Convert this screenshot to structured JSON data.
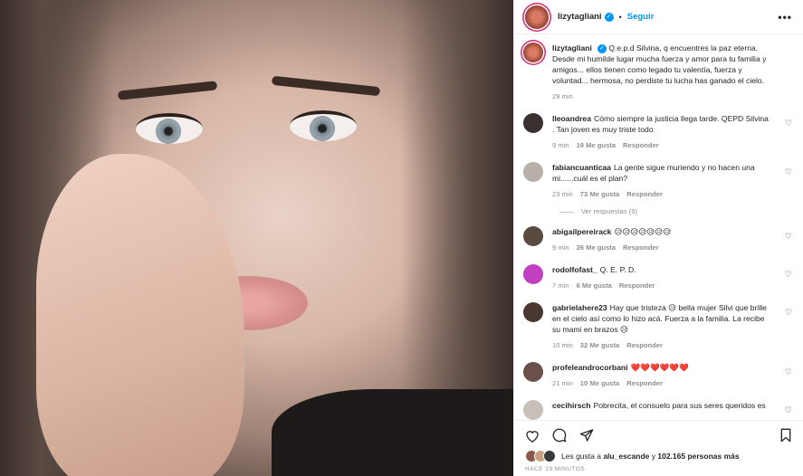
{
  "post_header": {
    "username": "lizytagliani",
    "separator": "•",
    "follow_label": "Seguir",
    "more_icon": "more-horizontal-icon",
    "verified_icon": "verified-badge-icon"
  },
  "caption": {
    "username": "lizytagliani",
    "text": "Q.e.p.d Silvina, q encuentres la paz eterna. Desde mi humilde lugar mucha fuerza y amor para tu familia y amigos... ellos tienen como legado tu valentía, fuerza y voluntad... hermosa, no perdiste tu lucha has ganado el cielo.",
    "time": "29 min"
  },
  "comments": [
    {
      "user": "lleoandrea",
      "text": "Cómo siempre la justicia llega tarde. QEPD Silvina . Tan joven es muy triste todo",
      "time": "9 min",
      "likes": "19 Me gusta",
      "reply": "Responder",
      "avatar_color": "#3a3030"
    },
    {
      "user": "fabiancuanticaa",
      "text": "La gente sigue muriendo y no hacen una mi......cuál es el plan?",
      "time": "23 min",
      "likes": "73 Me gusta",
      "reply": "Responder",
      "avatar_color": "#b8b0a8"
    },
    {
      "user": "abigailpereirack",
      "text": "😥😥😥😥😥😥😥",
      "time": "9 min",
      "likes": "26 Me gusta",
      "reply": "Responder",
      "avatar_color": "#5a4a40"
    },
    {
      "user": "rodolfofast_",
      "text": "Q. E. P. D.",
      "time": "7 min",
      "likes": "6 Me gusta",
      "reply": "Responder",
      "avatar_color": "#c040c0"
    },
    {
      "user": "gabrielahere23",
      "text": "Hay que tristeza 😥 bella mujer Silvi que brille en el cielo así como lo hizo acá. Fuerza a la familia. La recibe su mami en brazos 😥",
      "time": "10 min",
      "likes": "32 Me gusta",
      "reply": "Responder",
      "avatar_color": "#4a3830"
    },
    {
      "user": "profeleandrocorbani",
      "text": "❤️❤️❤️❤️❤️❤️",
      "time": "21 min",
      "likes": "10 Me gusta",
      "reply": "Responder",
      "avatar_color": "#6a5048"
    },
    {
      "user": "cecihirsch",
      "text": "Pobrecita, el consuelo para sus seres queridos es",
      "time": "",
      "likes": "",
      "reply": "",
      "avatar_color": "#c8c0b8"
    }
  ],
  "view_replies": "Ver respuestas (9)",
  "footer": {
    "likes_prefix": "Les gusta a",
    "likes_user": "alu_escande",
    "likes_mid": "y",
    "likes_count": "102.165 personas más",
    "timestamp": "HACE 29 MINUTOS",
    "icons": [
      "heart-icon",
      "comment-icon",
      "share-icon",
      "bookmark-icon"
    ]
  },
  "colors": {
    "accent": "#0095f6",
    "muted": "#8e8e8e",
    "text": "#262626"
  }
}
